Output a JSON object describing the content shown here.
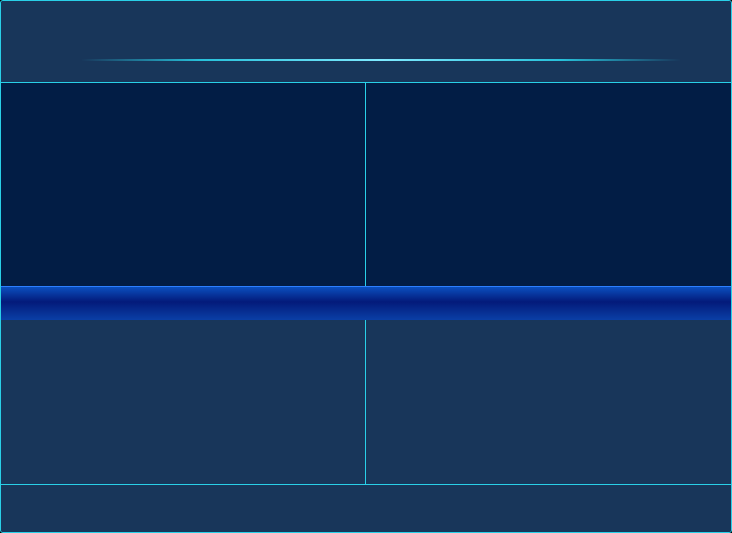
{
  "header": {
    "title": ""
  },
  "band": {
    "label": ""
  },
  "footer": {
    "text": ""
  },
  "colors": {
    "border": "#29d0e8",
    "frame_bg": "#18365a",
    "panel_dark_bg": "#021d45",
    "band_blue": "#031a7a"
  }
}
